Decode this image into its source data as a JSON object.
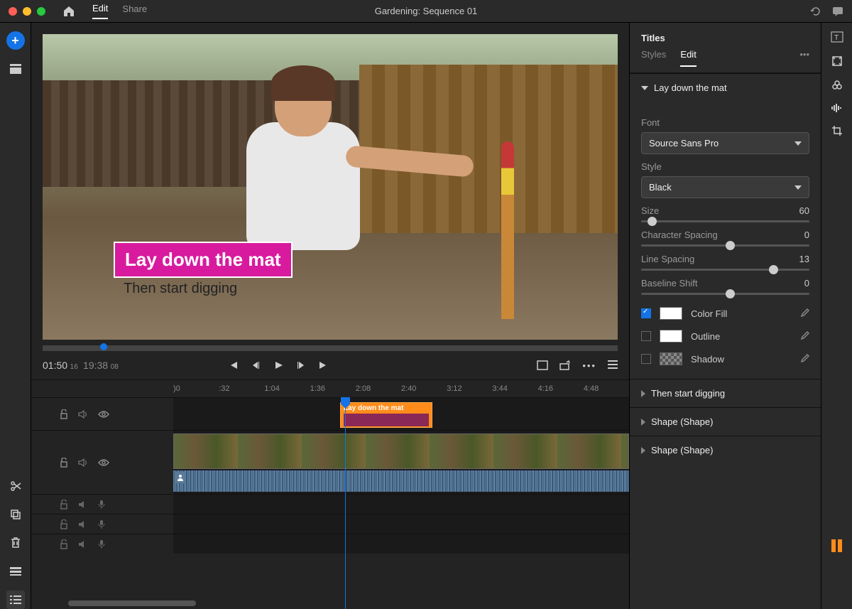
{
  "titlebar": {
    "home_label": "Home",
    "nav": {
      "edit": "Edit",
      "share": "Share"
    },
    "document_title": "Gardening: Sequence 01"
  },
  "preview": {
    "title_text": "Lay down the mat",
    "subtitle_text": "Then start digging"
  },
  "transport": {
    "current_time": "01:50",
    "current_frames": "16",
    "total_time": "19:38",
    "total_frames": "08"
  },
  "ruler": {
    "marks": [
      ")0",
      ":32",
      "1:04",
      "1:36",
      "2:08",
      "2:40",
      "3:12",
      "3:44",
      "4:16",
      "4:48"
    ]
  },
  "timeline": {
    "title_clip_label": "Lay down the mat"
  },
  "titles_panel": {
    "header": "Titles",
    "tabs": {
      "styles": "Styles",
      "edit": "Edit"
    },
    "section_title": "Lay down the mat",
    "font_label": "Font",
    "font_value": "Source Sans Pro",
    "style_label": "Style",
    "style_value": "Black",
    "size_label": "Size",
    "size_value": "60",
    "charspacing_label": "Character Spacing",
    "charspacing_value": "0",
    "linespacing_label": "Line Spacing",
    "linespacing_value": "13",
    "baseline_label": "Baseline Shift",
    "baseline_value": "0",
    "colorfill_label": "Color Fill",
    "outline_label": "Outline",
    "shadow_label": "Shadow",
    "sections": {
      "then_start": "Then start digging",
      "shape1": "Shape (Shape)",
      "shape2": "Shape (Shape)"
    }
  },
  "slider_positions": {
    "size_pct": 4,
    "charspacing_pct": 50,
    "linespacing_pct": 76,
    "baseline_pct": 50
  }
}
